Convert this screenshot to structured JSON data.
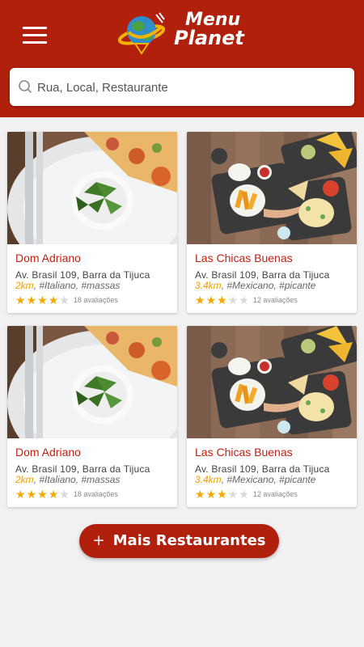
{
  "header": {
    "logo_line1": "Menu",
    "logo_line2": "Planet"
  },
  "search": {
    "placeholder": "Rua, Local, Restaurante"
  },
  "restaurants": [
    {
      "name": "Dom Adriano",
      "address": "Av. Brasil 109, Barra da Tijuca",
      "distance": "2km",
      "tags": "#Italiano, #massas",
      "rating": 4,
      "reviews": "18 avaliações",
      "image": "pizza"
    },
    {
      "name": "Las Chicas Buenas",
      "address": "Av. Brasil 109, Barra da Tijuca",
      "distance": "3.4km",
      "tags": "#Mexicano, #picante",
      "rating": 3,
      "reviews": "12 avaliações",
      "image": "mexican"
    },
    {
      "name": "Dom Adriano",
      "address": "Av. Brasil 109, Barra da Tijuca",
      "distance": "2km",
      "tags": "#Italiano, #massas",
      "rating": 4,
      "reviews": "18 avaliações",
      "image": "pizza"
    },
    {
      "name": "Las Chicas Buenas",
      "address": "Av. Brasil 109, Barra da Tijuca",
      "distance": "3.4km",
      "tags": "#Mexicano, #picante",
      "rating": 3,
      "reviews": "12 avaliações",
      "image": "mexican"
    }
  ],
  "more_button": {
    "plus": "+",
    "label": "Mais Restaurantes"
  },
  "colors": {
    "brand": "#b0200c",
    "star": "#f7a700",
    "distance": "#f0a000"
  }
}
